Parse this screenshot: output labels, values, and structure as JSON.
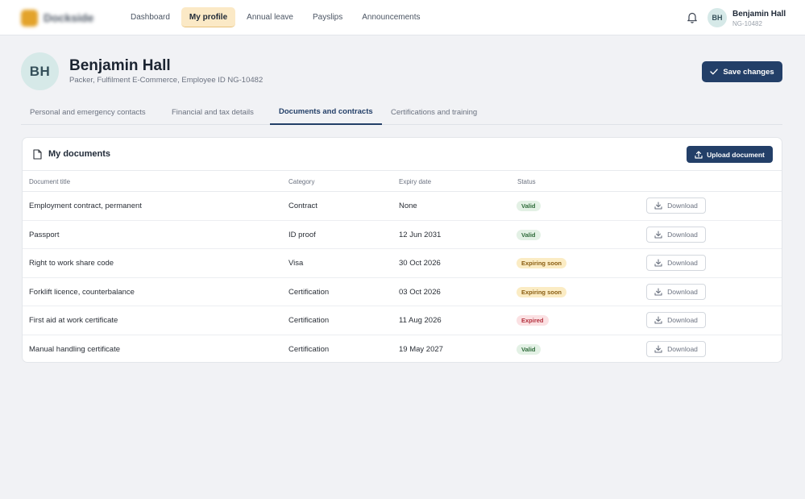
{
  "app": {
    "brand": "Dockside",
    "nav": [
      {
        "label": "Dashboard"
      },
      {
        "label": "My profile"
      },
      {
        "label": "Annual leave"
      },
      {
        "label": "Payslips"
      },
      {
        "label": "Announcements"
      }
    ],
    "active_nav": "My profile",
    "user": {
      "initials": "BH",
      "name": "Benjamin Hall",
      "id": "NG-10482"
    }
  },
  "profile": {
    "initials": "BH",
    "name": "Benjamin Hall",
    "subtitle": "Packer, Fulfilment E-Commerce, Employee ID NG-10482",
    "save_label": "Save changes"
  },
  "tabs": [
    {
      "label": "Personal and emergency contacts"
    },
    {
      "label": "Financial and tax details"
    },
    {
      "label": "Documents and contracts"
    },
    {
      "label": "Certifications and training"
    }
  ],
  "active_tab": "Documents and contracts",
  "documents": {
    "title": "My documents",
    "upload_label": "Upload document",
    "columns": [
      "Document title",
      "Category",
      "Expiry date",
      "Status"
    ],
    "download_label": "Download",
    "rows": [
      {
        "title": "Employment contract, permanent",
        "category": "Contract",
        "expiry": "None",
        "status": "Valid",
        "status_kind": "valid"
      },
      {
        "title": "Passport",
        "category": "ID proof",
        "expiry": "12 Jun 2031",
        "status": "Valid",
        "status_kind": "valid"
      },
      {
        "title": "Right to work share code",
        "category": "Visa",
        "expiry": "30 Oct 2026",
        "status": "Expiring soon",
        "status_kind": "soon"
      },
      {
        "title": "Forklift licence, counterbalance",
        "category": "Certification",
        "expiry": "03 Oct 2026",
        "status": "Expiring soon",
        "status_kind": "soon"
      },
      {
        "title": "First aid at work certificate",
        "category": "Certification",
        "expiry": "11 Aug 2026",
        "status": "Expired",
        "status_kind": "expired"
      },
      {
        "title": "Manual handling certificate",
        "category": "Certification",
        "expiry": "19 May 2027",
        "status": "Valid",
        "status_kind": "valid"
      }
    ]
  },
  "colors": {
    "primary": "#233f68",
    "accent": "#e3a32b",
    "valid": "#2f6b3a",
    "expiring": "#8a5d12",
    "expired": "#b3303d"
  },
  "icons": [
    "bell-icon",
    "check-icon",
    "document-icon",
    "upload-icon",
    "download-icon"
  ]
}
